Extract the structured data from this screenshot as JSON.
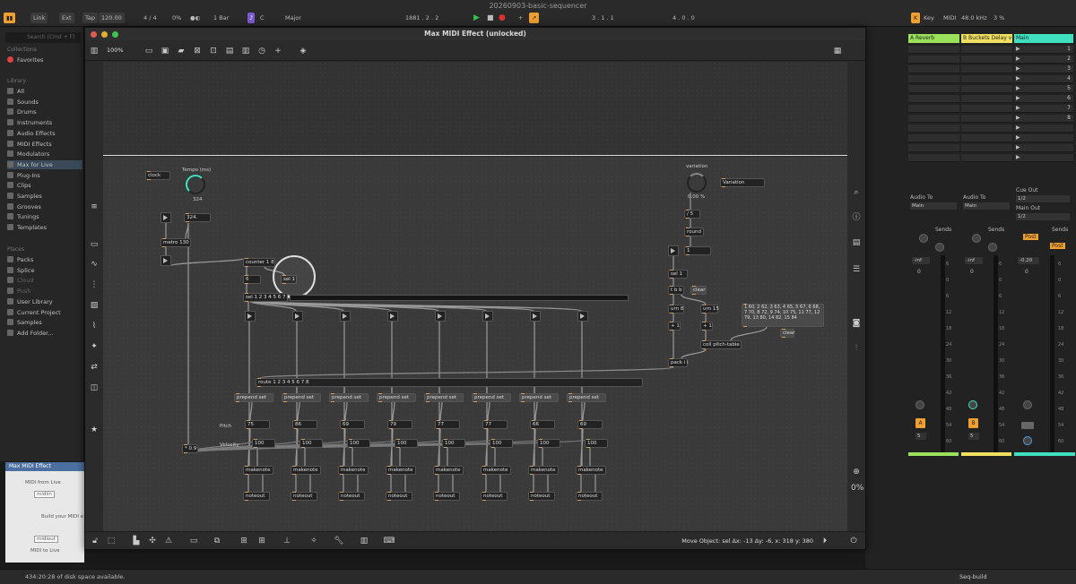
{
  "live": {
    "title": "20260903-basic-sequencer",
    "link": "Link",
    "ext": "Ext",
    "tap": "Tap",
    "tempo": "120.00",
    "signature": "4 / 4",
    "groove": "0%",
    "quantize": "1 Bar",
    "key": "C",
    "scale": "Major",
    "position": "1881 . 2 . 2",
    "loop_start": "3 . 1 . 1",
    "loop_length": "4 . 0 . 0",
    "key_label": "Key",
    "midi_label": "MIDI",
    "sample_rate": "48.0 kHz",
    "cpu": "3 %"
  },
  "browser": {
    "search": "Search (Cmd + F)",
    "collections_label": "Collections",
    "favorites": "Favorites",
    "library_label": "Library",
    "library_items": [
      "All",
      "Sounds",
      "Drums",
      "Instruments",
      "Audio Effects",
      "MIDI Effects",
      "Modulators",
      "Max for Live",
      "Plug-Ins",
      "Clips",
      "Samples",
      "Grooves",
      "Tunings",
      "Templates"
    ],
    "places_label": "Places",
    "places_items": [
      "Packs",
      "Splice",
      "Cloud",
      "Push",
      "User Library",
      "Current Project",
      "Samples",
      "Add Folder..."
    ]
  },
  "preview": {
    "title": "Max MIDI Effect",
    "midi_from": "MIDI from Live",
    "midiin": "midiin",
    "build": "Build your MIDI e",
    "midiout": "midiout",
    "midi_to": "MIDI to Live"
  },
  "maxwin": {
    "title": "Max MIDI Effect (unlocked)",
    "zoom": "100%",
    "status": "Move Object: sel Δx: -13 Δy: -6, x: 318 y: 380"
  },
  "patch": {
    "clock": "clock",
    "tempo_label": "Tempo (ms)",
    "tempo_value": "324",
    "tempo_num": "324.",
    "metro": "metro 130",
    "counter": "counter 1 8",
    "sel_obj": "sel 1",
    "num6": "6",
    "sel_main": "sel 1 2 3 4 5 6 7 8",
    "route": "route 1 2 3 4 5 6 7 8",
    "prepend": "prepend set",
    "pitch_label": "Pitch",
    "velocity_label": "Velocity",
    "mult": "* 0.9",
    "makenote": "makenote",
    "noteout": "noteout",
    "pitches": [
      "75",
      "86",
      "69",
      "79",
      "77",
      "77",
      "66",
      "69"
    ],
    "velocity": "100",
    "variation_label": "variation",
    "variation_value": "0.00 %",
    "variation_comment": "Variation",
    "div5": "/ 5",
    "round": "round",
    "val1": "1",
    "sel1": "sel 1",
    "tbb": "t b b",
    "clear": "clear",
    "urn8": "urn 8",
    "urn15": "urn 15",
    "plus1": "+ 1",
    "coll": "coll pitch-table",
    "pack": "pack i i",
    "coll_msg": "1 60, 2 62, 3 63, 4 65, 5 67, 6 68, 7 70, 8 72, 9 74, 10 75, 11 77, 12 79, 13 80, 14 82, 15 84"
  },
  "mixer": {
    "tracks": [
      {
        "name": "A Reverb",
        "color": "#9be05a",
        "audio_to": "Audio To",
        "route": "Main",
        "vol": "-inf",
        "pan": "0",
        "btn": "A",
        "num": "5"
      },
      {
        "name": "B Buckets Delay v",
        "color": "#f0e060",
        "audio_to": "Audio To",
        "route": "Main",
        "vol": "-inf",
        "pan": "0",
        "btn": "B",
        "num": "5"
      },
      {
        "name": "Main",
        "color": "#3fe0c0",
        "audio_to": "Cue Out",
        "route": "1/2",
        "main_out": "Main Out",
        "main_route": "1/2",
        "vol": "-0.20",
        "pan": "0"
      }
    ],
    "sends": "Sends",
    "post": "Post",
    "clip_numbers": [
      "1",
      "2",
      "3",
      "4",
      "5",
      "6",
      "7",
      "8"
    ],
    "db_marks": [
      "6",
      "0",
      "6",
      "12",
      "18",
      "24",
      "30",
      "36",
      "42",
      "48",
      "54",
      "60"
    ]
  },
  "footer": {
    "disk": "434:20:28 of disk space available.",
    "seq": "Seq-build"
  }
}
